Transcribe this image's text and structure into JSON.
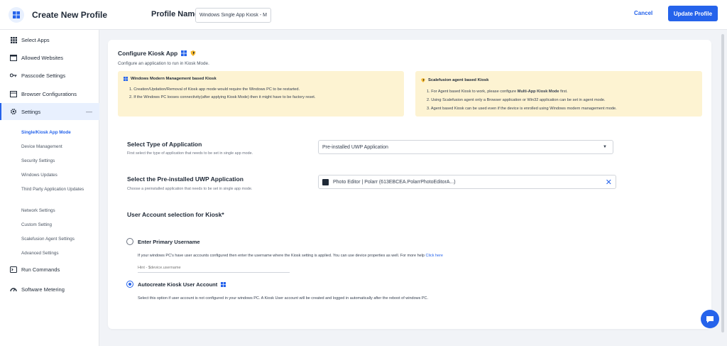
{
  "header": {
    "title": "Create New Profile",
    "profile_name_label": "Profile Name",
    "profile_name_value": "Windows Single App Kiosk - Micro",
    "cancel_label": "Cancel",
    "update_label": "Update Profile",
    "accent_color": "#2563eb"
  },
  "sidebar": {
    "items": [
      {
        "label": "Select Apps",
        "icon": "grid-icon"
      },
      {
        "label": "Allowed Websites",
        "icon": "browser-window-icon"
      },
      {
        "label": "Passcode Settings",
        "icon": "key-icon"
      },
      {
        "label": "Browser Configurations",
        "icon": "browser-config-icon"
      },
      {
        "label": "Settings",
        "icon": "gear-icon",
        "expanded": true
      },
      {
        "label": "Run Commands",
        "icon": "terminal-icon"
      },
      {
        "label": "Software Metering",
        "icon": "gauge-icon"
      }
    ],
    "settings_subitems": [
      "Single/Kiosk App Mode",
      "Device Management",
      "Security Settings",
      "Windows Updates",
      "Third Party Application Updates",
      "Network Settings",
      "Custom Setting",
      "Scalefusion Agent Settings",
      "Advanced Settings"
    ]
  },
  "main": {
    "title": "Configure Kiosk App",
    "subtitle": "Configure an application to run in Kiosk Mode.",
    "note_left": {
      "title": "Windows Modern Management based Kiosk",
      "lines": [
        "1. Creation/Updation/Removal of Kiosk app mode would require the Windows PC to be restarted.",
        "2. If the Windows PC looses connectivity(after applying Kiosk Mode) then it might have to be factory reset."
      ]
    },
    "note_right": {
      "title": "Scalefusion agent based Kiosk",
      "line1_prefix": "1. For Agent based Kiosk to work, please configure ",
      "line1_bold": "Multi-App Kiosk Mode",
      "line1_suffix": " first.",
      "line2": "2. Using Scalefusion agent only a Browser application or Win32 application can be set in agent mode.",
      "line3": "3. Agent based Kiosk can be used even if the device is enrolled using Windows modern management mode."
    },
    "app_type": {
      "title": "Select Type of Application",
      "desc": "First select the type of application that needs to be set in single app mode.",
      "value": "Pre-installed UWP Application"
    },
    "uwp_app": {
      "title": "Select the Pre-installed UWP Application",
      "desc": "Choose a preinstalled application that needs to be set in single app mode.",
      "value": "Photo Editor | Polarr (613EBCEA.PolarrPhotoEditorA...)"
    },
    "user_account": {
      "title": "User Account selection for Kiosk*",
      "option1_label": "Enter Primary Username",
      "option1_desc": "If your windows PC's have user accounts configured then enter the username where the Kiosk setting is applied. You can use device properties as well. For more help",
      "option1_link": "Click here",
      "option1_hint": "Hint - $device.username",
      "option2_label": "Autocreate Kiosk User Account",
      "option2_desc": "Select this option if user account is not configured in your windows PC. A Kiosk User account will be created and logged in automatically after the reboot of windows PC."
    }
  }
}
